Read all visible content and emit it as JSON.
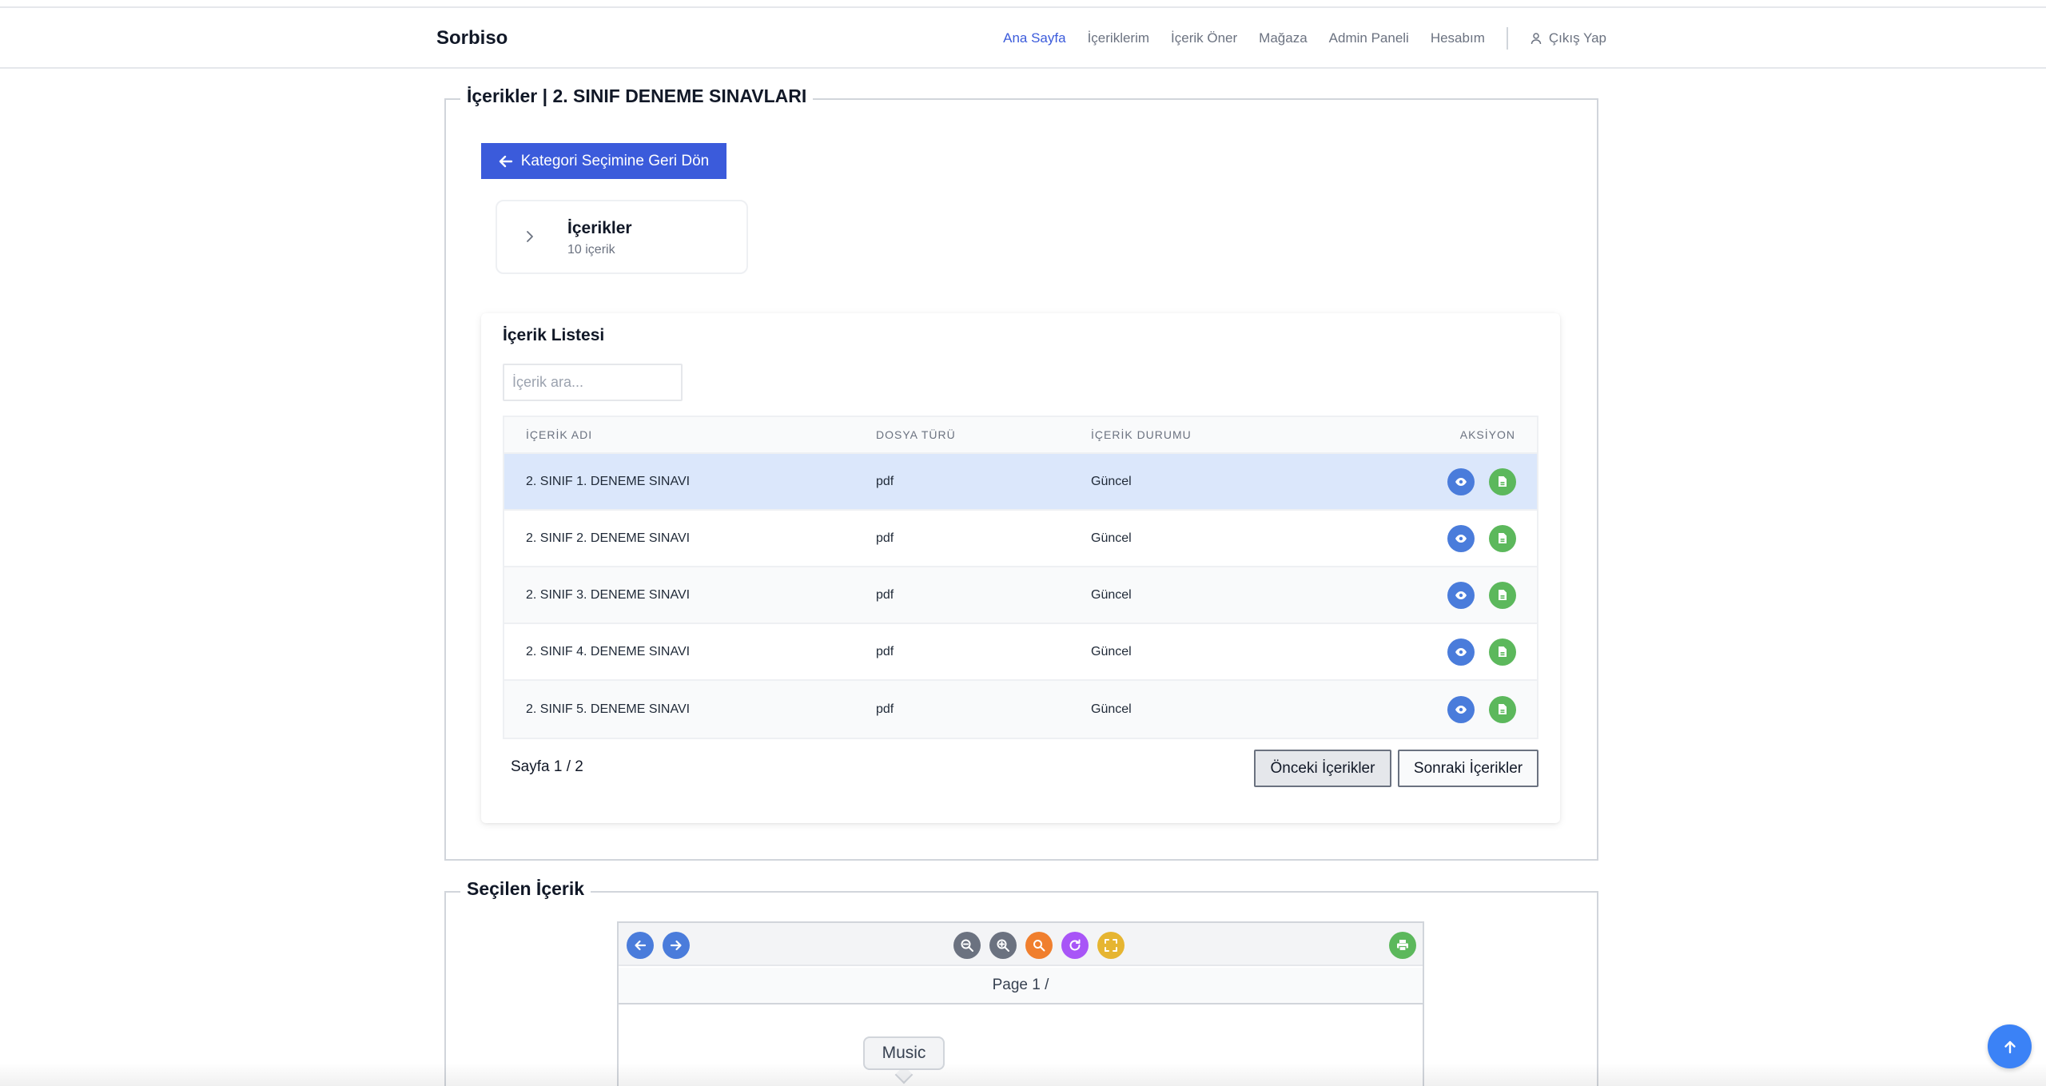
{
  "nav": {
    "brand": "Sorbiso",
    "links": [
      "Ana Sayfa",
      "İçeriklerim",
      "İçerik Öner",
      "Mağaza",
      "Admin Paneli",
      "Hesabım"
    ],
    "logout": "Çıkış Yap"
  },
  "contents_panel": {
    "legend": "İçerikler | 2. SINIF DENEME SINAVLARI",
    "back_button": "Kategori Seçimine Geri Dön",
    "category": {
      "title": "İçerikler",
      "count": "10 içerik"
    }
  },
  "list": {
    "title": "İçerik Listesi",
    "search_placeholder": "İçerik ara...",
    "columns": [
      "İÇERİK ADI",
      "DOSYA TÜRÜ",
      "İÇERİK DURUMU",
      "AKSİYON"
    ],
    "rows": [
      {
        "name": "2. SINIF 1. DENEME SINAVI",
        "type": "pdf",
        "status": "Güncel"
      },
      {
        "name": "2. SINIF 2. DENEME SINAVI",
        "type": "pdf",
        "status": "Güncel"
      },
      {
        "name": "2. SINIF 3. DENEME SINAVI",
        "type": "pdf",
        "status": "Güncel"
      },
      {
        "name": "2. SINIF 4. DENEME SINAVI",
        "type": "pdf",
        "status": "Güncel"
      },
      {
        "name": "2. SINIF 5. DENEME SINAVI",
        "type": "pdf",
        "status": "Güncel"
      }
    ],
    "page_info": "Sayfa 1 / 2",
    "prev_button": "Önceki İçerikler",
    "next_button": "Sonraki İçerikler"
  },
  "selected_panel": {
    "legend": "Seçilen İçerik",
    "page_label": "Page 1 /",
    "tooltip": "Music"
  },
  "colors": {
    "primary": "#3b5bdb",
    "view": "#4a7cdb",
    "file": "#5cb85c",
    "zoom": "#6b7280",
    "search": "#f07f2e",
    "rotate": "#a855f7",
    "fullscreen": "#e6b531",
    "print": "#5cb85c"
  }
}
